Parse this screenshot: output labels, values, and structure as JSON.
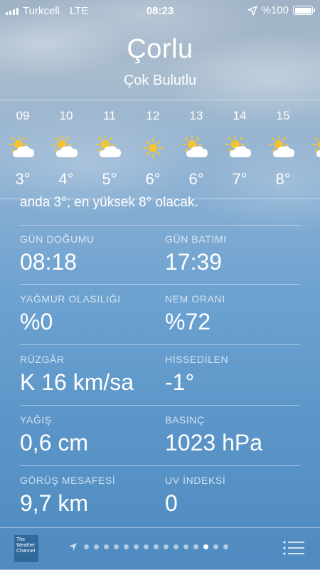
{
  "status": {
    "carrier": "Turkcell",
    "network": "LTE",
    "time": "08:23",
    "battery": "%100"
  },
  "location": {
    "city": "Çorlu",
    "condition": "Çok Bulutlu"
  },
  "hourly": [
    {
      "hour": "09",
      "icon": "partly-cloudy",
      "temp": "3°"
    },
    {
      "hour": "10",
      "icon": "partly-cloudy",
      "temp": "4°"
    },
    {
      "hour": "11",
      "icon": "partly-cloudy",
      "temp": "5°"
    },
    {
      "hour": "12",
      "icon": "sunny",
      "temp": "6°"
    },
    {
      "hour": "13",
      "icon": "partly-cloudy",
      "temp": "6°"
    },
    {
      "hour": "14",
      "icon": "partly-cloudy",
      "temp": "7°"
    },
    {
      "hour": "15",
      "icon": "partly-cloudy",
      "temp": "8°"
    }
  ],
  "summary": "anda 3°; en yüksek 8° olacak.",
  "details": [
    {
      "label": "GÜN DOĞUMU",
      "value": "08:18"
    },
    {
      "label": "GÜN BATIMI",
      "value": "17:39"
    },
    {
      "label": "YAĞMUR OLASILIĞI",
      "value": "%0"
    },
    {
      "label": "NEM ORANI",
      "value": "%72"
    },
    {
      "label": "RÜZGÂR",
      "value": "K 16 km/sa"
    },
    {
      "label": "HİSSEDİLEN",
      "value": "-1°"
    },
    {
      "label": "YAĞIŞ",
      "value": "0,6 cm"
    },
    {
      "label": "BASINÇ",
      "value": "1023 hPa"
    },
    {
      "label": "GÖRÜŞ MESAFESİ",
      "value": "9,7 km"
    },
    {
      "label": "UV İNDEKSİ",
      "value": "0"
    }
  ],
  "toolbar": {
    "logo_text": "The Weather Channel",
    "page_count": 15,
    "active_page": 12
  },
  "colors": {
    "sun": "#f4c430",
    "cloud": "#ffffff"
  }
}
